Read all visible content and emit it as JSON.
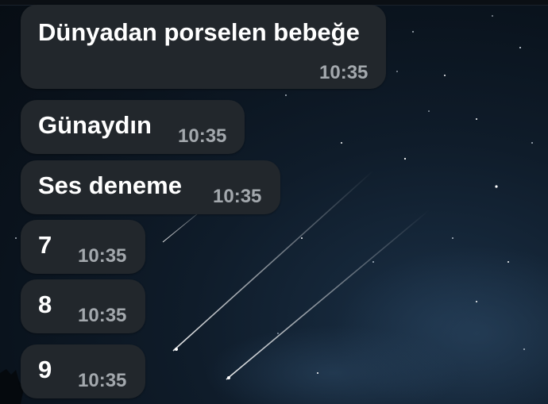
{
  "chat": {
    "messages": [
      {
        "text": "Dünyadan porselen bebeğe",
        "time": "10:35"
      },
      {
        "text": "Günaydın",
        "time": "10:35"
      },
      {
        "text": "Ses deneme",
        "time": "10:35"
      },
      {
        "text": "7",
        "time": "10:35"
      },
      {
        "text": "8",
        "time": "10:35"
      },
      {
        "text": "9",
        "time": "10:35"
      }
    ]
  },
  "colors": {
    "bubble": "#22272c",
    "text": "#ffffff",
    "time": "#a3a8ad",
    "background": "#0a131d"
  }
}
